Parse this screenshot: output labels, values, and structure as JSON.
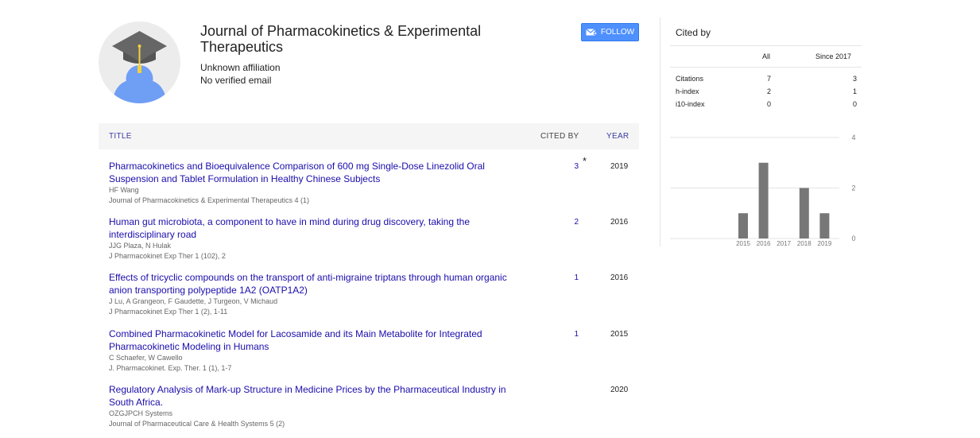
{
  "profile": {
    "name": "Journal of Pharmacokinetics & Experimental Therapeutics",
    "affiliation": "Unknown affiliation",
    "email": "No verified email",
    "follow_label": "FOLLOW",
    "avatar_icon": "graduation-cap-avatar-icon",
    "follow_icon": "envelope-plus-icon"
  },
  "table": {
    "headers": {
      "title": "TITLE",
      "cited_by": "CITED BY",
      "year": "YEAR"
    },
    "rows": [
      {
        "title": "Pharmacokinetics and Bioequivalence Comparison of 600 mg Single-Dose Linezolid Oral Suspension and Tablet Formulation in Healthy Chinese Subjects",
        "authors": "HF Wang",
        "venue": "Journal of Pharmacokinetics & Experimental Therapeutics 4 (1)",
        "cited_by": "3",
        "star": "*",
        "year": "2019"
      },
      {
        "title": "Human gut microbiota, a component to have in mind during drug discovery, taking the interdisciplinary road",
        "authors": "JJG Plaza, N Hulak",
        "venue": "J Pharmacokinet Exp Ther 1 (102), 2",
        "cited_by": "2",
        "star": "",
        "year": "2016"
      },
      {
        "title": "Effects of tricyclic compounds on the transport of anti-migraine triptans through human organic anion transporting polypeptide 1A2 (OATP1A2)",
        "authors": "J Lu, A Grangeon, F Gaudette, J Turgeon, V Michaud",
        "venue": "J Pharmacokinet Exp Ther 1 (2), 1-11",
        "cited_by": "1",
        "star": "",
        "year": "2016"
      },
      {
        "title": "Combined Pharmacokinetic Model for Lacosamide and its Main Metabolite for Integrated Pharmacokinetic Modeling in Humans",
        "authors": "C Schaefer, W Cawello",
        "venue": "J. Pharmacokinet. Exp. Ther. 1 (1), 1-7",
        "cited_by": "1",
        "star": "",
        "year": "2015"
      },
      {
        "title": "Regulatory Analysis of Mark-up Structure in Medicine Prices by the Pharmaceutical Industry in South Africa.",
        "authors": "OZGJPCH Systems",
        "venue": "Journal of Pharmaceutical Care & Health Systems 5 (2)",
        "cited_by": "",
        "star": "",
        "year": "2020"
      }
    ]
  },
  "cited_by": {
    "title": "Cited by",
    "columns": {
      "all": "All",
      "since": "Since 2017"
    },
    "metrics": [
      {
        "label": "Citations",
        "all": "7",
        "since": "3"
      },
      {
        "label": "h-index",
        "all": "2",
        "since": "1"
      },
      {
        "label": "i10-index",
        "all": "0",
        "since": "0"
      }
    ]
  },
  "chart_data": {
    "type": "bar",
    "categories": [
      "2015",
      "2016",
      "2017",
      "2018",
      "2019"
    ],
    "values": [
      1,
      3,
      0,
      2,
      1
    ],
    "y_ticks": [
      "4",
      "2",
      "0"
    ],
    "ylim": [
      0,
      4
    ],
    "bar_color": "#777777",
    "grid": true
  }
}
